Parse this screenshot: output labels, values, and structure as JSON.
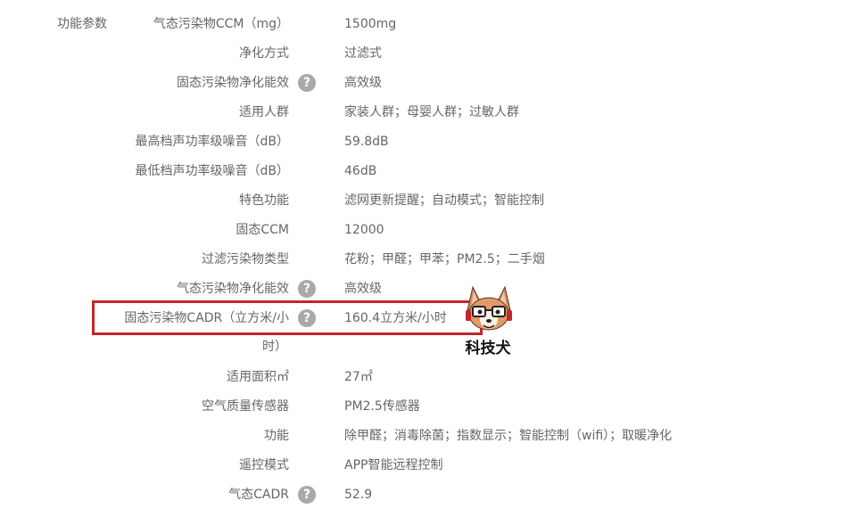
{
  "section_label": "功能参数",
  "help_glyph": "?",
  "rows": [
    {
      "label": "气态污染物CCM（mg）",
      "value": "1500mg",
      "help": false
    },
    {
      "label": "净化方式",
      "value": "过滤式",
      "help": false
    },
    {
      "label": "固态污染物净化能效",
      "value": "高效级",
      "help": true
    },
    {
      "label": "适用人群",
      "value": "家装人群；母婴人群；过敏人群",
      "help": false
    },
    {
      "label": "最高档声功率级噪音（dB）",
      "value": "59.8dB",
      "help": false
    },
    {
      "label": "最低档声功率级噪音（dB）",
      "value": "46dB",
      "help": false
    },
    {
      "label": "特色功能",
      "value": "滤网更新提醒；自动模式；智能控制",
      "help": false
    },
    {
      "label": "固态CCM",
      "value": "12000",
      "help": false
    },
    {
      "label": "过滤污染物类型",
      "value": "花粉；甲醛；甲苯；PM2.5；二手烟",
      "help": false
    },
    {
      "label": "气态污染物净化能效",
      "value": "高效级",
      "help": true
    },
    {
      "label": "固态污染物CADR（立方米/小",
      "label_tail": "时）",
      "value": "160.4立方米/小时",
      "help": true
    },
    {
      "label": "适用面积㎡",
      "value": "27㎡",
      "help": false
    },
    {
      "label": "空气质量传感器",
      "value": "PM2.5传感器",
      "help": false
    },
    {
      "label": "功能",
      "value": "除甲醛；消毒除菌；指数显示；智能控制（wifi）；取暖净化",
      "help": false
    },
    {
      "label": "遥控模式",
      "value": "APP智能远程控制",
      "help": false
    },
    {
      "label": "气态CADR",
      "value": "52.9",
      "help": true
    }
  ],
  "watermark": {
    "text": "科技犬",
    "name": "dog-mascot-watermark"
  },
  "colors": {
    "text": "#666666",
    "help_icon_bg": "#a9a9a9",
    "highlight_border": "#c0272d"
  }
}
